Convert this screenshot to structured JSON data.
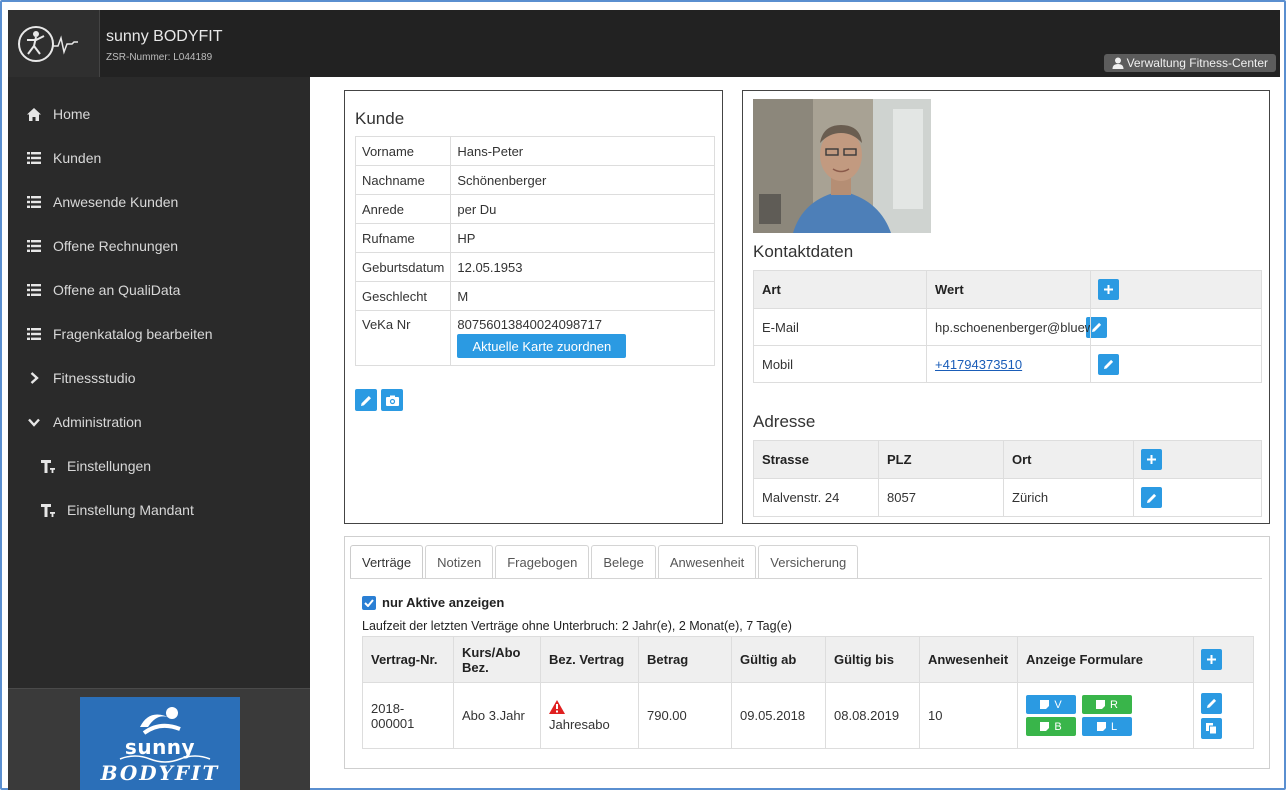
{
  "app": {
    "name": "sunny BODYFIT",
    "zsr": "ZSR-Nummer: L044189",
    "user_menu": "Verwaltung Fitness-Center"
  },
  "sidebar": {
    "items": [
      {
        "label": "Home",
        "icon": "home-icon"
      },
      {
        "label": "Kunden",
        "icon": "list-icon"
      },
      {
        "label": "Anwesende Kunden",
        "icon": "list-icon"
      },
      {
        "label": "Offene Rechnungen",
        "icon": "list-icon"
      },
      {
        "label": "Offene an QualiData",
        "icon": "list-icon"
      },
      {
        "label": "Fragenkatalog bearbeiten",
        "icon": "list-icon"
      },
      {
        "label": "Fitnessstudio",
        "icon": "chevron-right-icon"
      },
      {
        "label": "Administration",
        "icon": "chevron-down-icon"
      },
      {
        "label": "Einstellungen",
        "icon": "text-size-icon"
      },
      {
        "label": "Einstellung Mandant",
        "icon": "text-size-icon"
      }
    ],
    "logo_top": "sunny",
    "logo_bottom": "BODYFIT"
  },
  "kunde": {
    "title": "Kunde",
    "rows": [
      {
        "key": "Vorname",
        "value": "Hans-Peter"
      },
      {
        "key": "Nachname",
        "value": "Schönenberger"
      },
      {
        "key": "Anrede",
        "value": "per Du"
      },
      {
        "key": "Rufname",
        "value": "HP"
      },
      {
        "key": "Geburtsdatum",
        "value": "12.05.1953"
      },
      {
        "key": "Geschlecht",
        "value": "M"
      },
      {
        "key": "VeKa Nr",
        "value": "80756013840024098717"
      }
    ],
    "assign_card_button": "Aktuelle Karte zuordnen"
  },
  "kontakt": {
    "title": "Kontaktdaten",
    "headers": [
      "Art",
      "Wert"
    ],
    "rows": [
      {
        "art": "E-Mail",
        "wert": "hp.schoenenberger@bluewin"
      },
      {
        "art": "Mobil",
        "wert": "+41794373510"
      }
    ]
  },
  "adresse": {
    "title": "Adresse",
    "headers": [
      "Strasse",
      "PLZ",
      "Ort"
    ],
    "row": {
      "strasse": "Malvenstr. 24",
      "plz": "8057",
      "ort": "Zürich"
    }
  },
  "tabs": [
    "Verträge",
    "Notizen",
    "Fragebogen",
    "Belege",
    "Anwesenheit",
    "Versicherung"
  ],
  "vertraege": {
    "only_active_label": "nur Aktive anzeigen",
    "only_active_checked": true,
    "laufzeit": "Laufzeit der letzten Verträge ohne Unterbruch: 2 Jahr(e), 2 Monat(e), 7 Tag(e)",
    "headers": [
      "Vertrag-Nr.",
      "Kurs/Abo Bez.",
      "Bez. Vertrag",
      "Betrag",
      "Gültig ab",
      "Gültig bis",
      "Anwesenheit",
      "Anzeige Formulare"
    ],
    "row": {
      "nr": "2018-000001",
      "kurs": "Abo 3.Jahr",
      "bez": "Jahresabo",
      "betrag": "790.00",
      "ab": "09.05.2018",
      "bis": "08.08.2019",
      "anwesenheit": "10"
    },
    "form_buttons": [
      {
        "label": "V",
        "color": "#2b9ae2"
      },
      {
        "label": "R",
        "color": "#39b54a"
      },
      {
        "label": "B",
        "color": "#39b54a"
      },
      {
        "label": "L",
        "color": "#2b9ae2"
      }
    ]
  },
  "colors": {
    "accent_blue": "#2b9ae2",
    "accent_green": "#39b54a",
    "sidebar_bg": "#2a2a2a",
    "topbar_bg": "#222222",
    "warning_red": "#e02020"
  }
}
